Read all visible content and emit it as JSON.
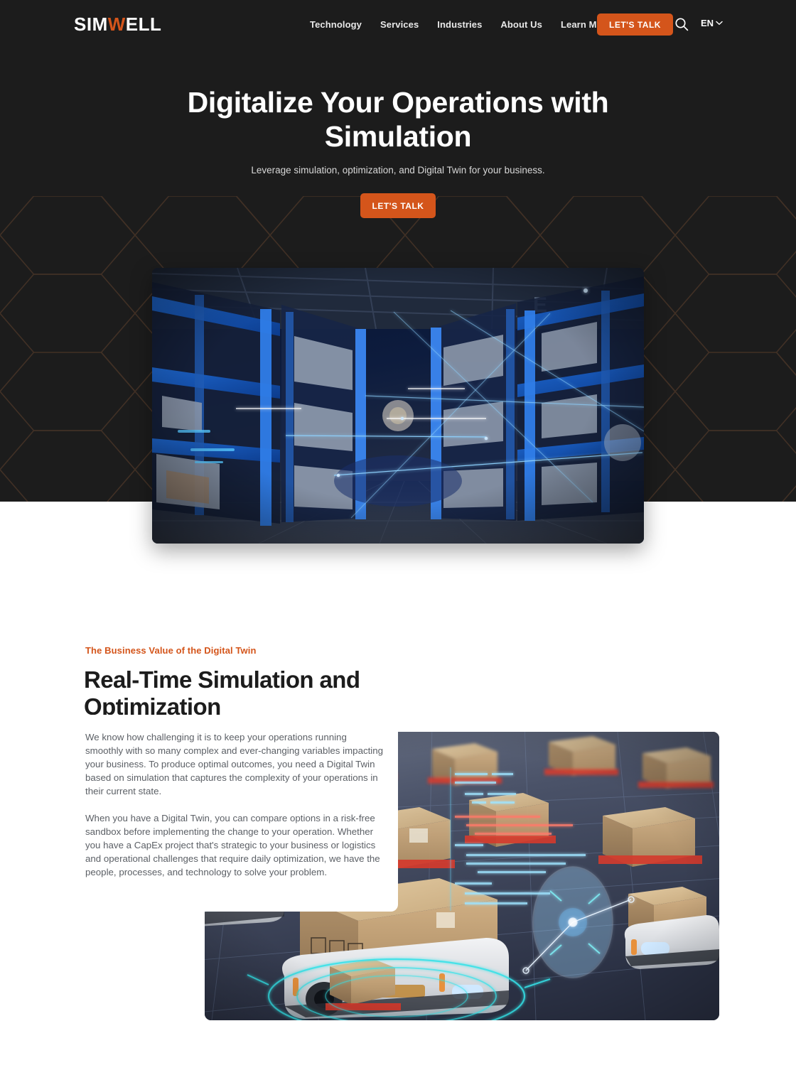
{
  "brand": {
    "logo_prefix": "SIM",
    "logo_accent": "W",
    "logo_suffix": "ELL",
    "accent_color": "#d4551b",
    "dark_bg": "#1c1c1c"
  },
  "header": {
    "nav": [
      {
        "label": "Technology"
      },
      {
        "label": "Services"
      },
      {
        "label": "Industries"
      },
      {
        "label": "About Us"
      },
      {
        "label": "Learn More"
      }
    ],
    "cta_label": "LET'S TALK",
    "search_icon": "search-icon",
    "language": {
      "selected": "EN",
      "chevron_icon": "chevron-down-icon"
    }
  },
  "hero": {
    "title": "Digitalize Your Operations with Simulation",
    "subtitle": "Leverage simulation, optimization, and Digital Twin for your business.",
    "cta_label": "LET'S TALK",
    "image_alt": "warehouse-digital-twin-image"
  },
  "section": {
    "eyebrow": "The Business Value of the Digital Twin",
    "title": "Real-Time Simulation and Optimization",
    "paragraphs": [
      "We know how challenging it is to keep your operations running smoothly with so many complex and ever-changing variables impacting your business. To produce optimal outcomes, you need a Digital Twin based on simulation that captures the complexity of your operations in their current state.",
      "When you have a Digital Twin, you can compare options in a risk-free sandbox before implementing the change to your operation. Whether you have a CapEx project that's strategic to your business or logistics and operational challenges that require daily optimization, we have the people, processes, and technology to solve your problem."
    ],
    "image_alt": "warehouse-agv-robots-image"
  }
}
